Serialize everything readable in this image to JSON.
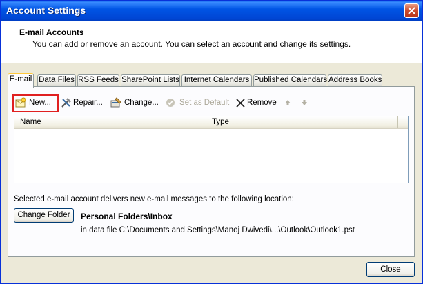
{
  "window": {
    "title": "Account Settings"
  },
  "header": {
    "title": "E-mail Accounts",
    "subtitle": "You can add or remove an account. You can select an account and change its settings."
  },
  "tabs": [
    {
      "label": "E-mail",
      "active": true
    },
    {
      "label": "Data Files"
    },
    {
      "label": "RSS Feeds"
    },
    {
      "label": "SharePoint Lists"
    },
    {
      "label": "Internet Calendars"
    },
    {
      "label": "Published Calendars"
    },
    {
      "label": "Address Books"
    }
  ],
  "toolbar": {
    "new": "New...",
    "repair": "Repair...",
    "change": "Change...",
    "set_default": "Set as Default",
    "remove": "Remove"
  },
  "accounts_list": {
    "columns": [
      "Name",
      "Type"
    ],
    "rows": []
  },
  "delivery": {
    "text": "Selected e-mail account delivers new e-mail messages to the following location:",
    "change_folder": "Change Folder",
    "folder": "Personal Folders\\Inbox",
    "path": "in data file C:\\Documents and Settings\\Manoj Dwivedi\\...\\Outlook\\Outlook1.pst"
  },
  "footer": {
    "close": "Close"
  }
}
